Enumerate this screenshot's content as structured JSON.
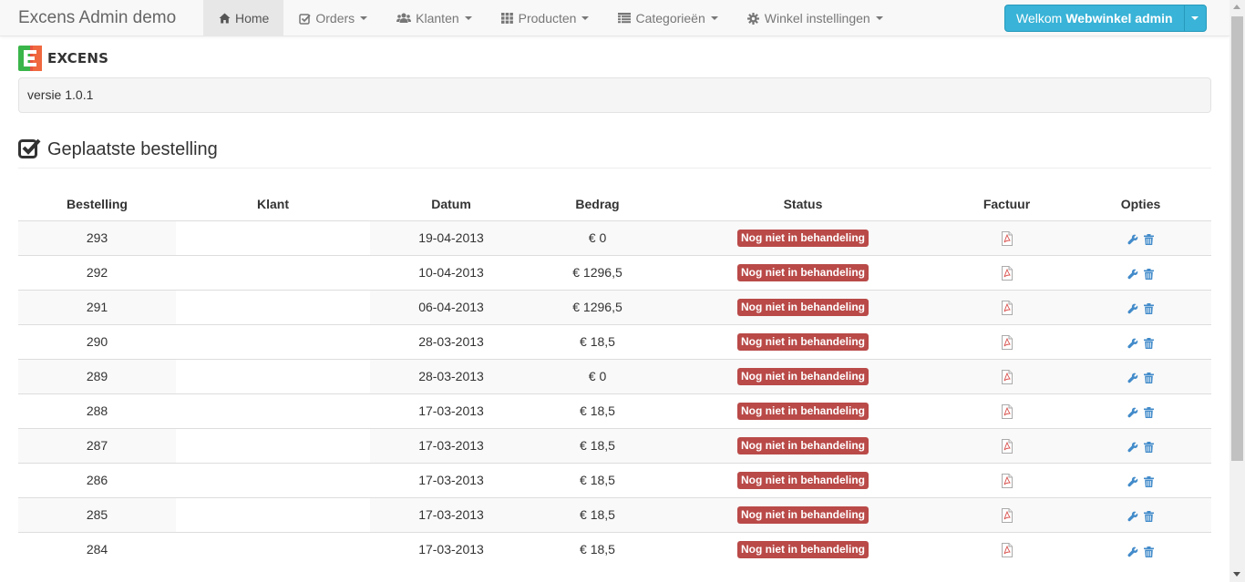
{
  "app": {
    "title": "Excens Admin demo"
  },
  "nav": {
    "items": [
      {
        "label": "Home",
        "icon": "home-icon",
        "active": true
      },
      {
        "label": "Orders",
        "icon": "check-square-icon"
      },
      {
        "label": "Klanten",
        "icon": "users-icon"
      },
      {
        "label": "Producten",
        "icon": "grid-icon"
      },
      {
        "label": "Categorieën",
        "icon": "list-icon"
      },
      {
        "label": "Winkel instellingen",
        "icon": "cog-icon"
      }
    ]
  },
  "user": {
    "welcome": "Welkom",
    "name": "Webwinkel admin"
  },
  "logo": {
    "text": "EXCENS"
  },
  "version": {
    "text": "versie 1.0.1"
  },
  "section": {
    "title": "Geplaatste bestelling"
  },
  "table": {
    "headers": [
      "Bestelling",
      "Klant",
      "Datum",
      "Bedrag",
      "Status",
      "Factuur",
      "Opties"
    ],
    "rows": [
      {
        "id": "293",
        "klant": "",
        "datum": "19-04-2013",
        "bedrag": "€ 0",
        "status": "Nog niet in behandeling"
      },
      {
        "id": "292",
        "klant": "",
        "datum": "10-04-2013",
        "bedrag": "€ 1296,5",
        "status": "Nog niet in behandeling"
      },
      {
        "id": "291",
        "klant": "",
        "datum": "06-04-2013",
        "bedrag": "€ 1296,5",
        "status": "Nog niet in behandeling"
      },
      {
        "id": "290",
        "klant": "",
        "datum": "28-03-2013",
        "bedrag": "€ 18,5",
        "status": "Nog niet in behandeling"
      },
      {
        "id": "289",
        "klant": "",
        "datum": "28-03-2013",
        "bedrag": "€ 0",
        "status": "Nog niet in behandeling"
      },
      {
        "id": "288",
        "klant": "",
        "datum": "17-03-2013",
        "bedrag": "€ 18,5",
        "status": "Nog niet in behandeling"
      },
      {
        "id": "287",
        "klant": "",
        "datum": "17-03-2013",
        "bedrag": "€ 18,5",
        "status": "Nog niet in behandeling"
      },
      {
        "id": "286",
        "klant": "",
        "datum": "17-03-2013",
        "bedrag": "€ 18,5",
        "status": "Nog niet in behandeling"
      },
      {
        "id": "285",
        "klant": "",
        "datum": "17-03-2013",
        "bedrag": "€ 18,5",
        "status": "Nog niet in behandeling"
      },
      {
        "id": "284",
        "klant": "",
        "datum": "17-03-2013",
        "bedrag": "€ 18,5",
        "status": "Nog niet in behandeling"
      }
    ]
  },
  "colors": {
    "status_badge": "#b94a48",
    "accent": "#39b3d7",
    "link_icon": "#428bca"
  }
}
